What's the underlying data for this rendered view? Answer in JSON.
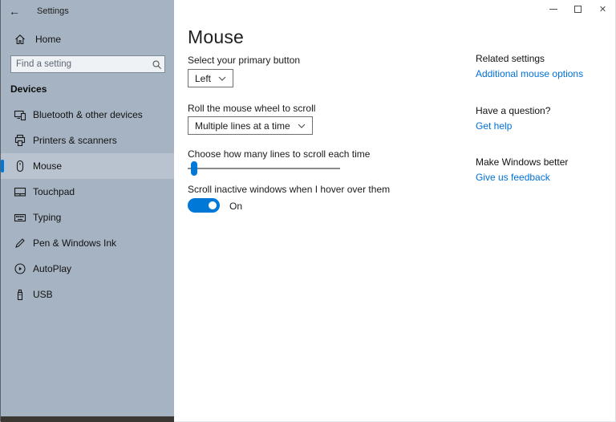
{
  "titlebar": {
    "title": "Settings",
    "back_glyph": "←",
    "close_glyph": "✕"
  },
  "sidebar": {
    "home_label": "Home",
    "search_placeholder": "Find a setting",
    "section_header": "Devices",
    "items": [
      {
        "label": "Bluetooth & other devices",
        "icon": "devices-icon",
        "selected": false
      },
      {
        "label": "Printers & scanners",
        "icon": "printer-icon",
        "selected": false
      },
      {
        "label": "Mouse",
        "icon": "mouse-icon",
        "selected": true
      },
      {
        "label": "Touchpad",
        "icon": "touchpad-icon",
        "selected": false
      },
      {
        "label": "Typing",
        "icon": "keyboard-icon",
        "selected": false
      },
      {
        "label": "Pen & Windows Ink",
        "icon": "pen-icon",
        "selected": false
      },
      {
        "label": "AutoPlay",
        "icon": "autoplay-icon",
        "selected": false
      },
      {
        "label": "USB",
        "icon": "usb-icon",
        "selected": false
      }
    ]
  },
  "main": {
    "title": "Mouse",
    "primary_button_label": "Select your primary button",
    "primary_button_value": "Left",
    "wheel_label": "Roll the mouse wheel to scroll",
    "wheel_value": "Multiple lines at a time",
    "lines_label": "Choose how many lines to scroll each time",
    "slider_position_percent": 3,
    "inactive_label": "Scroll inactive windows when I hover over them",
    "toggle_state": "On"
  },
  "aside": {
    "related_header": "Related settings",
    "related_link": "Additional mouse options",
    "question_header": "Have a question?",
    "question_link": "Get help",
    "feedback_header": "Make Windows better",
    "feedback_link": "Give us feedback"
  },
  "colors": {
    "accent": "#0078d7",
    "link": "#0070d8",
    "sidebar_bg": "#a6b3c2"
  }
}
